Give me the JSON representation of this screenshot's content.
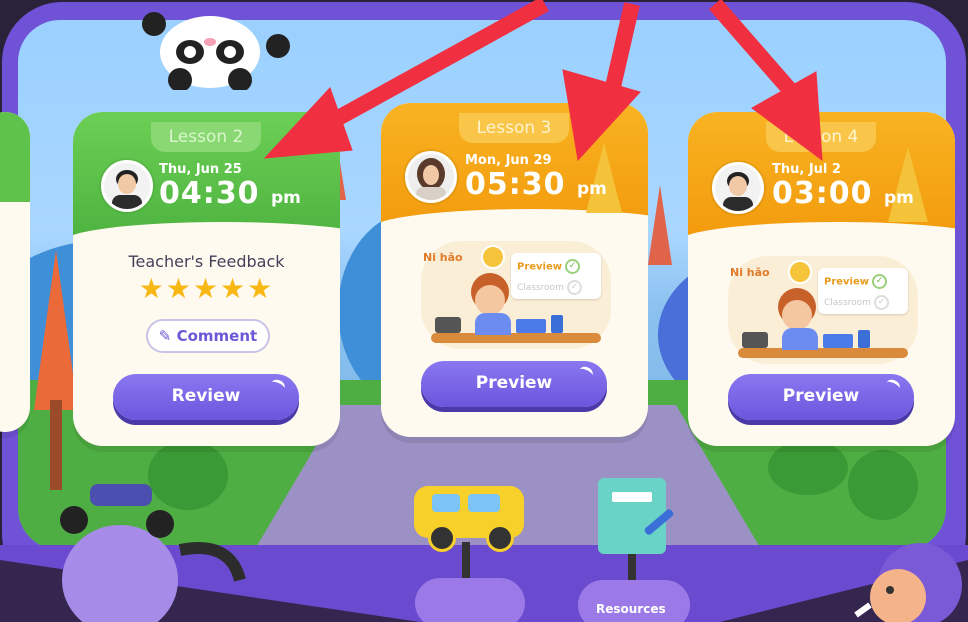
{
  "cards": [
    {
      "lesson": "Lesson 2",
      "date": "Thu, Jun 25",
      "time": "04:30",
      "ampm": "pm",
      "feedback_title": "Teacher's Feedback",
      "rating": "★★★★★",
      "comment_label": "Comment",
      "button": "Review",
      "theme": "#5fc24a"
    },
    {
      "lesson": "Lesson 3",
      "date": "Mon, Jun 29",
      "time": "05:30",
      "ampm": "pm",
      "button": "Preview",
      "theme": "#f6a814",
      "illustration": {
        "preview": "Preview",
        "classroom": "Classroom",
        "nihao": "Ni hǎo"
      }
    },
    {
      "lesson": "Lesson 4",
      "date": "Thu, Jul 2",
      "time": "03:00",
      "ampm": "pm",
      "button": "Preview",
      "theme": "#f6a814",
      "illustration": {
        "preview": "Preview",
        "classroom": "Classroom",
        "nihao": "Ni hǎo"
      }
    }
  ],
  "bottom_nav": {
    "resources_label": "Resources"
  },
  "colors": {
    "accent": "#6c55dd",
    "arrow": "#f03040",
    "star": "#f7b816"
  }
}
